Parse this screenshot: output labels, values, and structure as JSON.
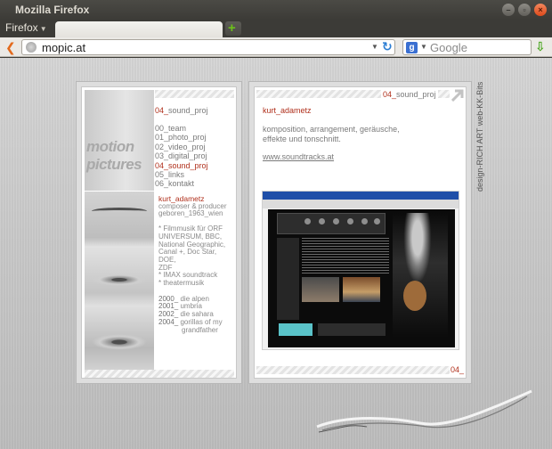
{
  "window": {
    "title": "Mozilla Firefox",
    "minimize": "–",
    "maximize": "▫",
    "close": "×"
  },
  "browser": {
    "menu_label": "Firefox",
    "tab_title": "",
    "url": "mopic.at",
    "search_placeholder": "Google",
    "search_engine_icon": "google-icon"
  },
  "site": {
    "logo_lines": [
      "motion",
      "pictures"
    ],
    "section": {
      "num": "04_",
      "name": "sound_proj"
    },
    "nav": [
      {
        "label": "00_team",
        "active": false
      },
      {
        "label": "01_photo_proj",
        "active": false
      },
      {
        "label": "02_video_proj",
        "active": false
      },
      {
        "label": "03_digital_proj",
        "active": false
      },
      {
        "label": "04_sound_proj",
        "active": true
      },
      {
        "label": "05_links",
        "active": false
      },
      {
        "label": "06_kontakt",
        "active": false
      }
    ],
    "bio": {
      "name": "kurt_adametz",
      "role": "composer & producer",
      "born": "geboren_1963_wien",
      "credits": [
        "* Filmmusik für ORF",
        "  UNIVERSUM,    BBC,",
        "National    Geographic,",
        "  Canal +, Doc Star,    DOE,",
        "ZDF",
        "* IMAX soundtrack",
        "* theatermusik"
      ],
      "works": [
        {
          "year": "2000_",
          "title": "die alpen"
        },
        {
          "year": "2001_",
          "title": "umbria"
        },
        {
          "year": "2002_",
          "title": "die sahara"
        },
        {
          "year": "2004_",
          "title": "gorillas of my"
        },
        {
          "year": "",
          "title": "grandfather"
        }
      ]
    },
    "detail": {
      "section_num": "04_",
      "section_name": "sound_proj",
      "name": "kurt_adametz",
      "description": "komposition, arrangement, geräusche, effekte und tonschnitt.",
      "link": "www.soundtracks.at",
      "bottom_num": "04_"
    },
    "side_credit": "design-RICH ART   web-KK-Bits"
  }
}
